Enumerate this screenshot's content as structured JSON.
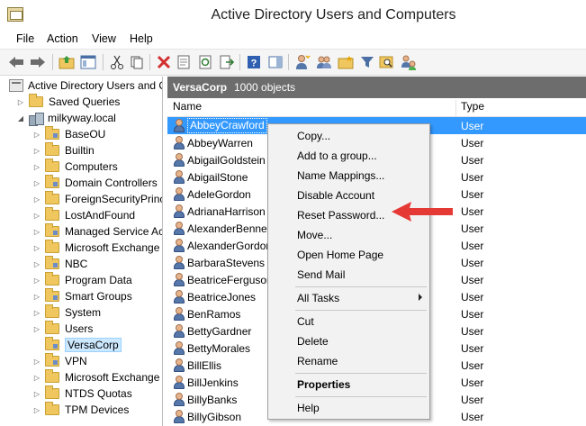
{
  "window": {
    "title": "Active Directory Users and Computers"
  },
  "menu": {
    "file": "File",
    "action": "Action",
    "view": "View",
    "help": "Help"
  },
  "toolbar": {
    "icons": [
      "back-arrow-icon",
      "forward-arrow-icon",
      "up-folder-icon",
      "show-console-tree-icon",
      "cut-icon",
      "copy-icon",
      "delete-icon",
      "properties-icon",
      "refresh-icon",
      "export-list-icon",
      "help-icon",
      "show-action-pane-icon",
      "new-user-icon",
      "new-group-icon",
      "new-ou-icon",
      "filter-icon",
      "find-icon",
      "add-to-group-icon"
    ]
  },
  "tree": {
    "root": "Active Directory Users and C",
    "saved_queries": "Saved Queries",
    "domain": "milkyway.local",
    "children": [
      "BaseOU",
      "Builtin",
      "Computers",
      "Domain Controllers",
      "ForeignSecurityPrinc",
      "LostAndFound",
      "Managed Service Ac",
      "Microsoft Exchange",
      "NBC",
      "Program Data",
      "Smart Groups",
      "System",
      "Users",
      "VersaCorp",
      "VPN",
      "Microsoft Exchange",
      "NTDS Quotas",
      "TPM Devices"
    ],
    "selected": "VersaCorp"
  },
  "content": {
    "container": "VersaCorp",
    "count": "1000 objects",
    "columns": {
      "name": "Name",
      "type": "Type"
    },
    "rows": [
      {
        "name": "AbbeyCrawford",
        "type": "User"
      },
      {
        "name": "AbbeyWarren",
        "type": "User"
      },
      {
        "name": "AbigailGoldstein",
        "type": "User"
      },
      {
        "name": "AbigailStone",
        "type": "User"
      },
      {
        "name": "AdeleGordon",
        "type": "User"
      },
      {
        "name": "AdrianaHarrison",
        "type": "User"
      },
      {
        "name": "AlexanderBennet",
        "type": "User"
      },
      {
        "name": "AlexanderGordon",
        "type": "User"
      },
      {
        "name": "BarbaraStevens",
        "type": "User"
      },
      {
        "name": "BeatriceFerguson",
        "type": "User"
      },
      {
        "name": "BeatriceJones",
        "type": "User"
      },
      {
        "name": "BenRamos",
        "type": "User"
      },
      {
        "name": "BettyGardner",
        "type": "User"
      },
      {
        "name": "BettyMorales",
        "type": "User"
      },
      {
        "name": "BillEllis",
        "type": "User"
      },
      {
        "name": "BillJenkins",
        "type": "User"
      },
      {
        "name": "BillyBanks",
        "type": "User"
      },
      {
        "name": "BillyGibson",
        "type": "User"
      }
    ]
  },
  "context_menu": {
    "items": [
      "Copy...",
      "Add to a group...",
      "Name Mappings...",
      "Disable Account",
      "Reset Password...",
      "Move...",
      "Open Home Page",
      "Send Mail",
      "All Tasks",
      "Cut",
      "Delete",
      "Rename",
      "Properties",
      "Help"
    ]
  },
  "colors": {
    "selection": "#3399ff",
    "header": "#6d6d6d",
    "annotation_arrow": "#e53935"
  }
}
